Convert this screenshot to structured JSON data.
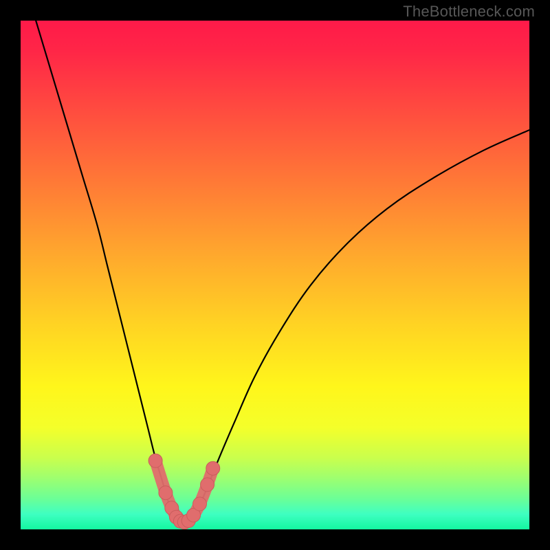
{
  "watermark": "TheBottleneck.com",
  "colors": {
    "gradient_stops": [
      {
        "offset": 0.0,
        "color": "#ff1a49"
      },
      {
        "offset": 0.06,
        "color": "#ff2647"
      },
      {
        "offset": 0.18,
        "color": "#ff4d3f"
      },
      {
        "offset": 0.32,
        "color": "#ff7a36"
      },
      {
        "offset": 0.46,
        "color": "#ffa82d"
      },
      {
        "offset": 0.6,
        "color": "#ffd423"
      },
      {
        "offset": 0.72,
        "color": "#fff61b"
      },
      {
        "offset": 0.8,
        "color": "#f4ff2a"
      },
      {
        "offset": 0.86,
        "color": "#c9ff4d"
      },
      {
        "offset": 0.9,
        "color": "#9dff70"
      },
      {
        "offset": 0.94,
        "color": "#6bff97"
      },
      {
        "offset": 0.97,
        "color": "#3effc1"
      },
      {
        "offset": 1.0,
        "color": "#14f7a0"
      }
    ],
    "curve_color": "#000000",
    "marker_fill": "#e06d6d",
    "marker_stroke": "#c95c5c",
    "frame_bg": "#000000"
  },
  "chart_data": {
    "type": "line",
    "title": "",
    "xlabel": "",
    "ylabel": "",
    "xlim": [
      0,
      100
    ],
    "ylim": [
      0,
      100
    ],
    "series": [
      {
        "name": "bottleneck-curve",
        "x": [
          3,
          6,
          9,
          12,
          15,
          17,
          19,
          21,
          23,
          25,
          26.5,
          28,
          29,
          30,
          31,
          32,
          33,
          34,
          35.5,
          37,
          39,
          42,
          46,
          51,
          57,
          64,
          72,
          81,
          91,
          100
        ],
        "y": [
          100,
          90,
          80,
          70,
          60,
          52,
          44,
          36,
          28,
          20,
          14,
          9,
          5.5,
          3,
          1.8,
          1.4,
          1.8,
          3,
          5.5,
          9,
          14,
          21,
          30,
          39,
          48,
          56,
          63,
          69,
          74.5,
          78.5
        ]
      }
    ],
    "markers": {
      "name": "highlighted-points",
      "x": [
        26.5,
        28.5,
        29.7,
        30.6,
        31.4,
        32.2,
        33,
        34,
        35.2,
        36.7,
        37.8
      ],
      "y": [
        13.5,
        7.2,
        4.2,
        2.4,
        1.6,
        1.4,
        1.7,
        2.8,
        5.0,
        8.8,
        12.0
      ]
    }
  }
}
